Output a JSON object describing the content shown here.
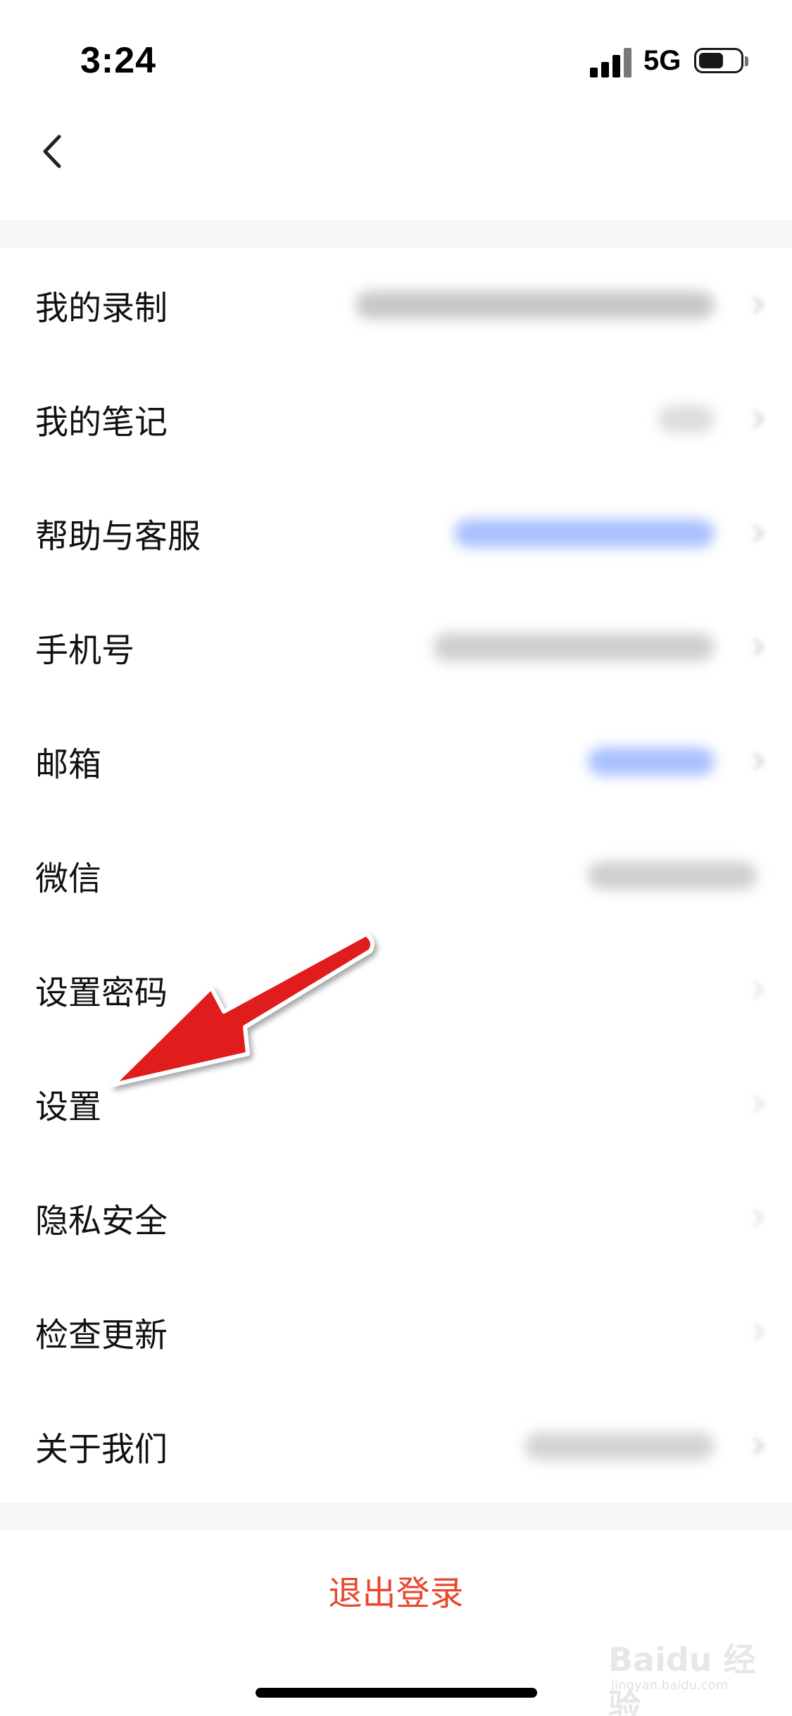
{
  "status_bar": {
    "time": "3:24",
    "network": "5G",
    "battery_level": 0.6
  },
  "nav": {
    "back_icon": "chevron-left-icon"
  },
  "menu": {
    "items": [
      {
        "label": "我的录制"
      },
      {
        "label": "我的笔记"
      },
      {
        "label": "帮助与客服"
      },
      {
        "label": "手机号"
      },
      {
        "label": "邮箱"
      },
      {
        "label": "微信"
      },
      {
        "label": "设置密码"
      },
      {
        "label": "设置"
      },
      {
        "label": "隐私安全"
      },
      {
        "label": "检查更新"
      },
      {
        "label": "关于我们"
      }
    ]
  },
  "logout": {
    "label": "退出登录"
  },
  "watermark": {
    "text": "Baidu 经验",
    "subtext": "jingyan.baidu.com"
  },
  "colors": {
    "logout_red": "#e8472e",
    "section_gap": "#f5f6f8",
    "annotation_arrow": "#e01f1f",
    "blurred_link_blue": "#4d7cff"
  }
}
